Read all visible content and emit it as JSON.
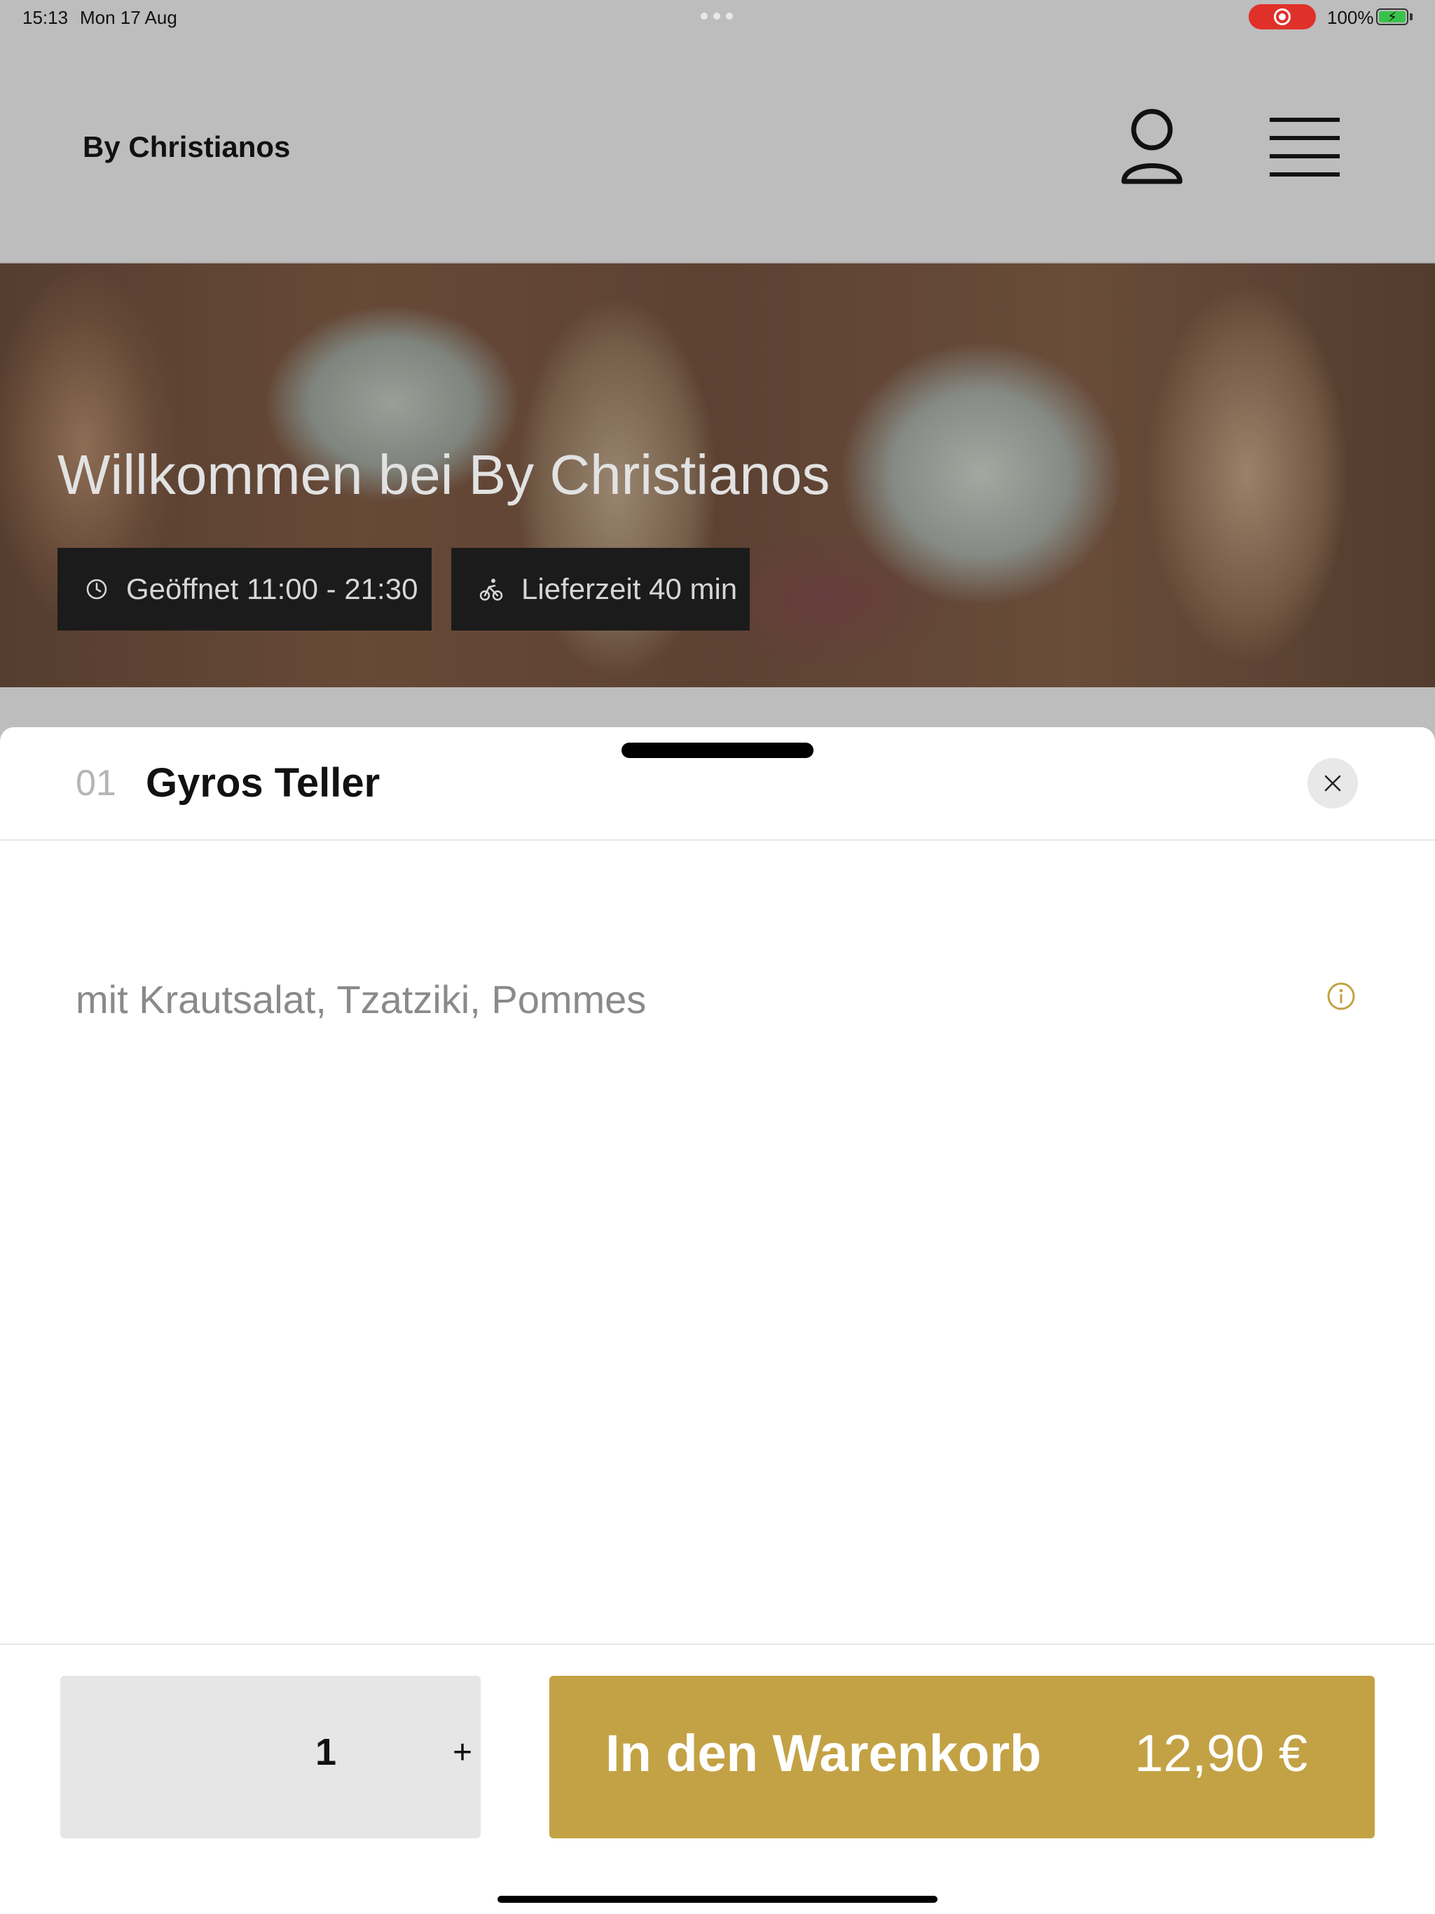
{
  "status_bar": {
    "time": "15:13",
    "date": "Mon 17 Aug",
    "battery_percent": "100%",
    "battery_level": 1.0,
    "recording_color": "#e0302a",
    "battery_color": "#39c24a"
  },
  "header": {
    "brand": "By Christianos",
    "account_icon": "user-icon",
    "menu_icon": "menu-icon"
  },
  "hero": {
    "title": "Willkommen bei By Christianos",
    "opening_hours": "Geöffnet 11:00 - 21:30",
    "opening_icon": "clock-icon",
    "delivery_time": "Lieferzeit 40 min",
    "delivery_icon": "bicycle-icon"
  },
  "item": {
    "number": "01",
    "title": "Gyros Teller",
    "description": "mit Krautsalat, Tzatziki, Pommes",
    "info_icon": "info-icon",
    "close_icon": "close-icon"
  },
  "footer": {
    "quantity": "1",
    "increment_label": "+",
    "add_to_cart_label": "In den Warenkorb",
    "price": "12,90 €",
    "accent_color": "#c3a245"
  }
}
